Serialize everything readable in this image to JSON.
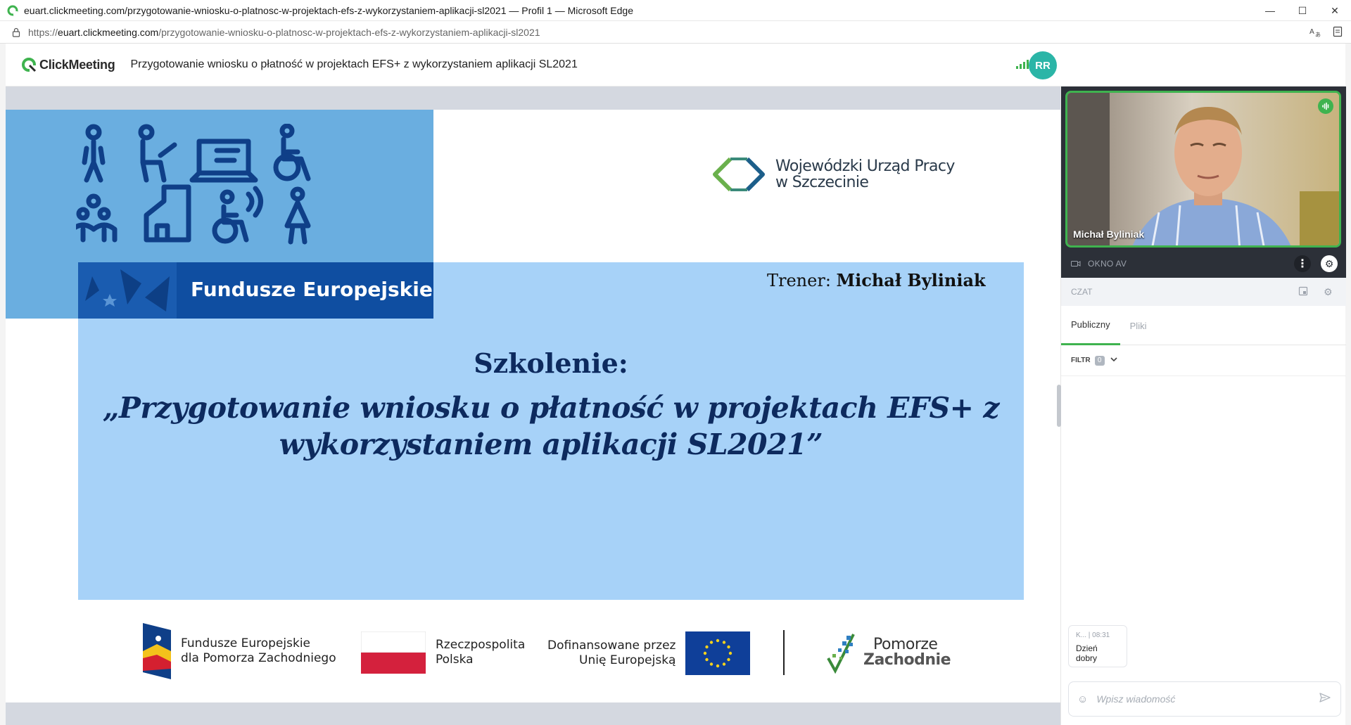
{
  "browser": {
    "window_title": "euart.clickmeeting.com/przygotowanie-wniosku-o-platnosc-w-projektach-efs-z-wykorzystaniem-aplikacji-sl2021 — Profil 1 — Microsoft Edge",
    "url_prefix": "https://",
    "url_host": "euart.clickmeeting.com",
    "url_path": "/przygotowanie-wniosku-o-platnosc-w-projektach-efs-z-wykorzystaniem-aplikacji-sl2021",
    "controls": {
      "minimize": "—",
      "maximize": "☐",
      "close": "✕"
    }
  },
  "app": {
    "logo_text": "ClickMeeting",
    "meeting_title": "Przygotowanie wniosku o płatność w projektach EFS+ z wykorzystaniem aplikacji SL2021",
    "avatar_initials": "RR",
    "accent_color": "#3fb34f",
    "avatar_color": "#2bb5a7"
  },
  "slide": {
    "fe_label": "Fundusze Europejskie",
    "wup_line1": "Wojewódzki Urząd Pracy",
    "wup_line2": "w Szczecinie",
    "trener_prefix": "Trener: ",
    "trener_name": "Michał Byliniak",
    "heading": "Szkolenie:",
    "course_line1": "„Przygotowanie wniosku o płatność  w projektach EFS+ z",
    "course_line2": "wykorzystaniem aplikacji SL2021”",
    "footer": {
      "fe_line1": "Fundusze Europejskie",
      "fe_line2": "dla Pomorza Zachodniego",
      "rp_line1": "Rzeczpospolita",
      "rp_line2": "Polska",
      "eu_line1": "Dofinansowane przez",
      "eu_line2": "Unię Europejską",
      "pz_line1": "Pomorze",
      "pz_line2": "Zachodnie"
    }
  },
  "sidebar": {
    "presenter_name": "Michał Byliniak",
    "av_label": "OKNO AV",
    "chat_label": "CZAT",
    "tabs": [
      {
        "label": "Publiczny",
        "active": true
      },
      {
        "label": "Pliki",
        "active": false
      }
    ],
    "filter_label": "FILTR",
    "filter_count": "0",
    "messages": [
      {
        "author": "K...",
        "time": "08:31",
        "text": "Dzień dobry"
      }
    ],
    "compose_placeholder": "Wpisz wiadomość"
  }
}
